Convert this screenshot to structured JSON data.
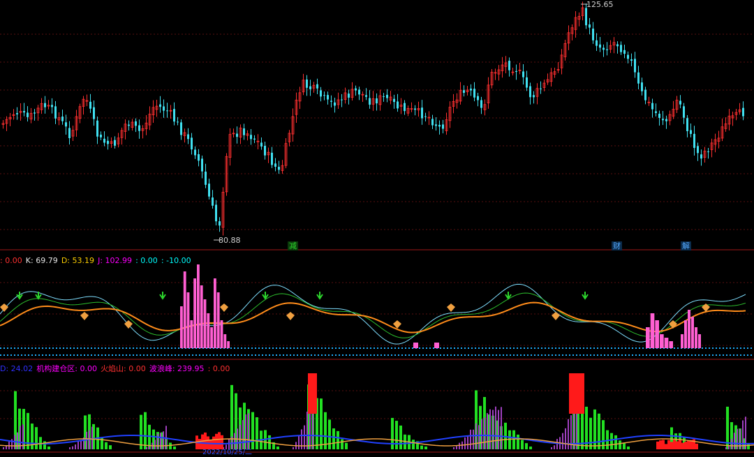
{
  "price_panel": {
    "high_label": "125.65",
    "low_label": "80.88",
    "markers": [
      {
        "text": "减",
        "color": "#2dd62d"
      },
      {
        "text": "财",
        "color": "#55aaff"
      },
      {
        "text": "解",
        "color": "#55aaff"
      }
    ]
  },
  "kdj_panel": {
    "header": [
      {
        "text": ": 0.00",
        "color": "#ff3030"
      },
      {
        "text": "K: 69.79",
        "color": "#e6e6e6"
      },
      {
        "text": "D: 53.19",
        "color": "#ffd000"
      },
      {
        "text": "J: 102.99",
        "color": "#ff00ff"
      },
      {
        "text": ": 0.00",
        "color": "#00ffff"
      },
      {
        "text": ": -10.00",
        "color": "#00ffff"
      }
    ]
  },
  "flow_panel": {
    "header": [
      {
        "text": "D: 24.02",
        "color": "#3030ff"
      },
      {
        "text": "机构建仓区: 0.00",
        "color": "#ff00ff"
      },
      {
        "text": "火焰山: 0.00",
        "color": "#ff3030"
      },
      {
        "text": "波浪峰: 239.95",
        "color": "#ff00ff"
      },
      {
        "text": ": 0.00",
        "color": "#ff3030"
      }
    ],
    "date_label": "2022/10/25/二"
  },
  "colors": {
    "up": "#ff3030",
    "down": "#40e0f0",
    "kline": "#7fdfff",
    "dline": "#2dbf2d",
    "jline": "#ff8c1a",
    "hist_pink": "#ff5fd2",
    "bar_green": "#22e022",
    "bar_purple": "#a040c0",
    "flame": "#ff1a1a"
  }
}
